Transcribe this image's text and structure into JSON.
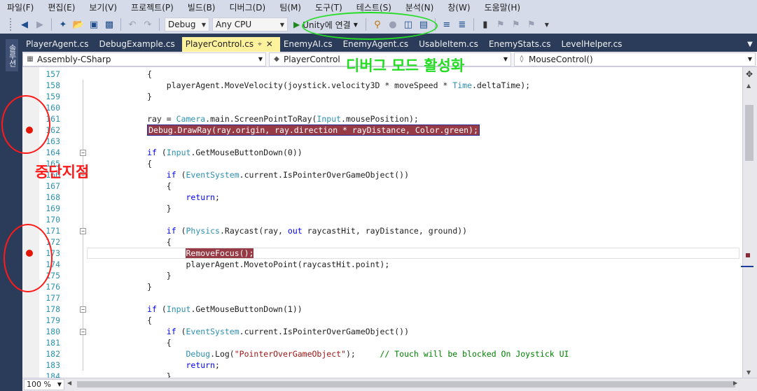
{
  "menu": [
    "파일(F)",
    "편집(E)",
    "보기(V)",
    "프로젝트(P)",
    "빌드(B)",
    "디버그(D)",
    "팀(M)",
    "도구(T)",
    "테스트(S)",
    "분석(N)",
    "창(W)",
    "도움말(H)"
  ],
  "toolbar": {
    "config": "Debug",
    "platform": "Any CPU",
    "attach_label": "Unity에 연결"
  },
  "left_tab": "솔루션",
  "tabs": [
    {
      "label": "PlayerAgent.cs",
      "active": false
    },
    {
      "label": "DebugExample.cs",
      "active": false
    },
    {
      "label": "PlayerControl.cs",
      "active": true
    },
    {
      "label": "EnemyAI.cs",
      "active": false
    },
    {
      "label": "EnemyAgent.cs",
      "active": false
    },
    {
      "label": "UsableItem.cs",
      "active": false
    },
    {
      "label": "EnemyStats.cs",
      "active": false
    },
    {
      "label": "LevelHelper.cs",
      "active": false
    }
  ],
  "nav": {
    "project": "Assembly-CSharp",
    "type": "PlayerControl",
    "member": "MouseControl()"
  },
  "zoom": "100 %",
  "annotations": {
    "debug_mode": "디버그 모드 활성화",
    "breakpoint": "중단지점"
  },
  "code_lines": [
    {
      "num": "157",
      "tokens": [
        {
          "t": "            {",
          "c": ""
        }
      ]
    },
    {
      "num": "158",
      "tokens": [
        {
          "t": "                playerAgent.MoveVelocity(joystick.velocity3D * moveSpeed * ",
          "c": ""
        },
        {
          "t": "Time",
          "c": "ty"
        },
        {
          "t": ".deltaTime);",
          "c": ""
        }
      ]
    },
    {
      "num": "159",
      "tokens": [
        {
          "t": "            }",
          "c": ""
        }
      ]
    },
    {
      "num": "160",
      "tokens": []
    },
    {
      "num": "161",
      "tokens": [
        {
          "t": "            ray = ",
          "c": ""
        },
        {
          "t": "Camera",
          "c": "ty"
        },
        {
          "t": ".main.ScreenPointToRay(",
          "c": ""
        },
        {
          "t": "Input",
          "c": "ty"
        },
        {
          "t": ".mousePosition);",
          "c": ""
        }
      ]
    },
    {
      "num": "162",
      "tokens": [
        {
          "t": "            ",
          "c": ""
        },
        {
          "t": "Debug.DrawRay(ray.origin, ray.direction * rayDistance, Color.green);",
          "c": "hl-box"
        }
      ],
      "bp": true
    },
    {
      "num": "163",
      "tokens": []
    },
    {
      "num": "164",
      "tokens": [
        {
          "t": "            ",
          "c": ""
        },
        {
          "t": "if",
          "c": "kw"
        },
        {
          "t": " (",
          "c": ""
        },
        {
          "t": "Input",
          "c": "ty"
        },
        {
          "t": ".GetMouseButtonDown(0))",
          "c": ""
        }
      ],
      "fold": true
    },
    {
      "num": "165",
      "tokens": [
        {
          "t": "            {",
          "c": ""
        }
      ]
    },
    {
      "num": "166",
      "tokens": [
        {
          "t": "                ",
          "c": ""
        },
        {
          "t": "if",
          "c": "kw"
        },
        {
          "t": " (",
          "c": ""
        },
        {
          "t": "EventSystem",
          "c": "ty"
        },
        {
          "t": ".current.IsPointerOverGameObject())",
          "c": ""
        }
      ],
      "fold": true
    },
    {
      "num": "167",
      "tokens": [
        {
          "t": "                {",
          "c": ""
        }
      ]
    },
    {
      "num": "168",
      "tokens": [
        {
          "t": "                    ",
          "c": ""
        },
        {
          "t": "return",
          "c": "kw"
        },
        {
          "t": ";",
          "c": ""
        }
      ]
    },
    {
      "num": "169",
      "tokens": [
        {
          "t": "                }",
          "c": ""
        }
      ]
    },
    {
      "num": "170",
      "tokens": []
    },
    {
      "num": "171",
      "tokens": [
        {
          "t": "                ",
          "c": ""
        },
        {
          "t": "if",
          "c": "kw"
        },
        {
          "t": " (",
          "c": ""
        },
        {
          "t": "Physics",
          "c": "ty"
        },
        {
          "t": ".Raycast(ray, ",
          "c": ""
        },
        {
          "t": "out",
          "c": "kw"
        },
        {
          "t": " raycastHit, rayDistance, ground))",
          "c": ""
        }
      ],
      "fold": true
    },
    {
      "num": "172",
      "tokens": [
        {
          "t": "                {",
          "c": ""
        }
      ]
    },
    {
      "num": "173",
      "tokens": [
        {
          "t": "                    ",
          "c": ""
        },
        {
          "t": "RemoveFocus();",
          "c": "hl-fill"
        }
      ],
      "bp": true,
      "current": true
    },
    {
      "num": "174",
      "tokens": [
        {
          "t": "                    playerAgent.MovetoPoint(raycastHit.point);",
          "c": ""
        }
      ]
    },
    {
      "num": "175",
      "tokens": [
        {
          "t": "                }",
          "c": ""
        }
      ]
    },
    {
      "num": "176",
      "tokens": [
        {
          "t": "            }",
          "c": ""
        }
      ]
    },
    {
      "num": "177",
      "tokens": []
    },
    {
      "num": "178",
      "tokens": [
        {
          "t": "            ",
          "c": ""
        },
        {
          "t": "if",
          "c": "kw"
        },
        {
          "t": " (",
          "c": ""
        },
        {
          "t": "Input",
          "c": "ty"
        },
        {
          "t": ".GetMouseButtonDown(1))",
          "c": ""
        }
      ],
      "fold": true
    },
    {
      "num": "179",
      "tokens": [
        {
          "t": "            {",
          "c": ""
        }
      ]
    },
    {
      "num": "180",
      "tokens": [
        {
          "t": "                ",
          "c": ""
        },
        {
          "t": "if",
          "c": "kw"
        },
        {
          "t": " (",
          "c": ""
        },
        {
          "t": "EventSystem",
          "c": "ty"
        },
        {
          "t": ".current.IsPointerOverGameObject())",
          "c": ""
        }
      ],
      "fold": true
    },
    {
      "num": "181",
      "tokens": [
        {
          "t": "                {",
          "c": ""
        }
      ]
    },
    {
      "num": "182",
      "tokens": [
        {
          "t": "                    ",
          "c": ""
        },
        {
          "t": "Debug",
          "c": "ty"
        },
        {
          "t": ".Log(",
          "c": ""
        },
        {
          "t": "\"PointerOverGameObject\"",
          "c": "st"
        },
        {
          "t": ");     ",
          "c": ""
        },
        {
          "t": "// Touch will be blocked On Joystick UI",
          "c": "cm"
        }
      ]
    },
    {
      "num": "183",
      "tokens": [
        {
          "t": "                    ",
          "c": ""
        },
        {
          "t": "return",
          "c": "kw"
        },
        {
          "t": ";",
          "c": ""
        }
      ]
    },
    {
      "num": "184",
      "tokens": [
        {
          "t": "                }",
          "c": ""
        }
      ]
    }
  ]
}
